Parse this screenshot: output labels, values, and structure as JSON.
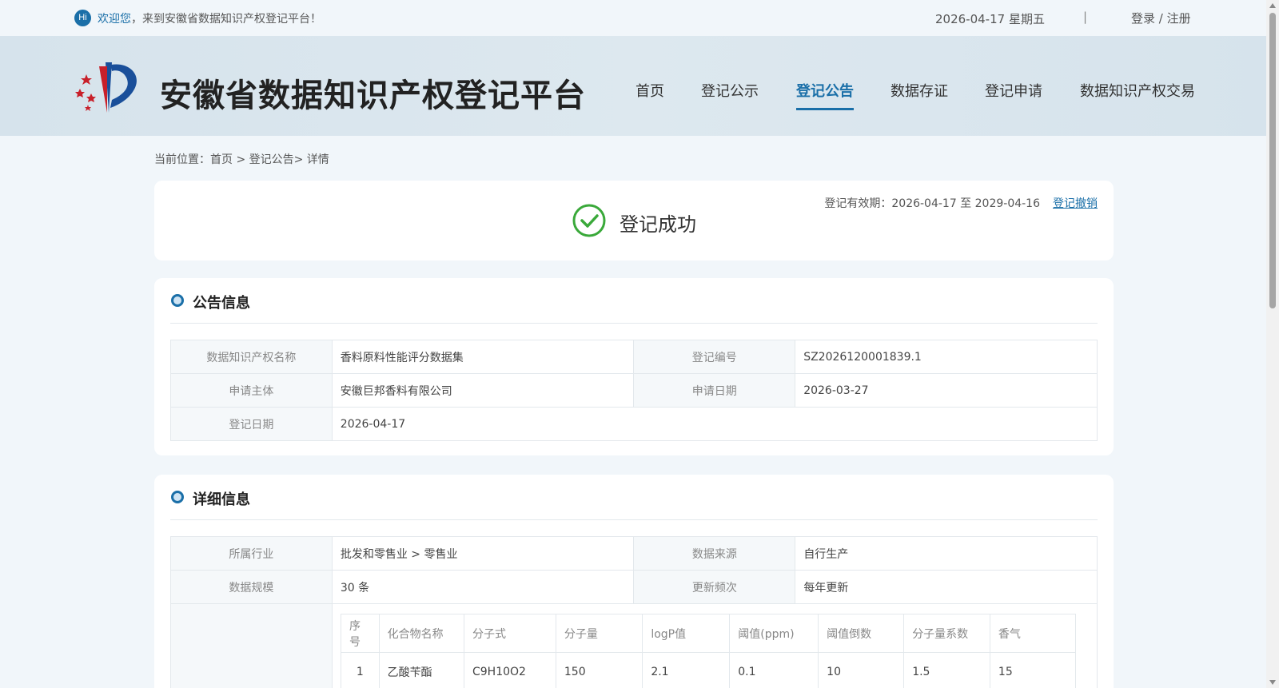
{
  "topbar": {
    "hi": "Hi",
    "welcome_highlight": "欢迎您",
    "welcome_rest": "，来到安徽省数据知识产权登记平台！",
    "date": "2026-04-17 星期五",
    "separator": "|",
    "login": "登录 / 注册"
  },
  "header": {
    "site_title": "安徽省数据知识产权登记平台",
    "nav": [
      "首页",
      "登记公示",
      "登记公告",
      "数据存证",
      "登记申请",
      "数据知识产权交易"
    ],
    "active_nav": "登记公告"
  },
  "breadcrumb": "当前位置：首页 > 登记公告> 详情",
  "status": {
    "validity": "登记有效期：2026-04-17 至 2029-04-16",
    "revoke": "登记撤销",
    "text": "登记成功",
    "color": "#3aa93a"
  },
  "announcement": {
    "title": "公告信息",
    "rows": [
      {
        "k1": "数据知识产权名称",
        "v1": "香料原料性能评分数据集",
        "k2": "登记编号",
        "v2": "SZ2026120001839.1"
      },
      {
        "k1": "申请主体",
        "v1": "安徽巨邦香料有限公司",
        "k2": "申请日期",
        "v2": "2026-03-27"
      },
      {
        "k1": "登记日期",
        "v1": "2026-04-17"
      }
    ]
  },
  "detail": {
    "title": "详细信息",
    "rows": [
      {
        "k1": "所属行业",
        "v1": "批发和零售业 > 零售业",
        "k2": "数据来源",
        "v2": "自行生产"
      },
      {
        "k1": "数据规模",
        "v1": "30 条",
        "k2": "更新频次",
        "v2": "每年更新"
      }
    ],
    "table": {
      "headers": [
        "序号",
        "化合物名称",
        "分子式",
        "分子量",
        "logP值",
        "阈值(ppm)",
        "阈值倒数",
        "分子量系数",
        "香气"
      ],
      "rows": [
        [
          "1",
          "乙酸苄酯",
          "C9H10O2",
          "150",
          "2.1",
          "0.1",
          "10",
          "1.5",
          "15"
        ]
      ]
    }
  },
  "colors": {
    "accent": "#1a6fa8",
    "background": "#f1f6fa"
  }
}
